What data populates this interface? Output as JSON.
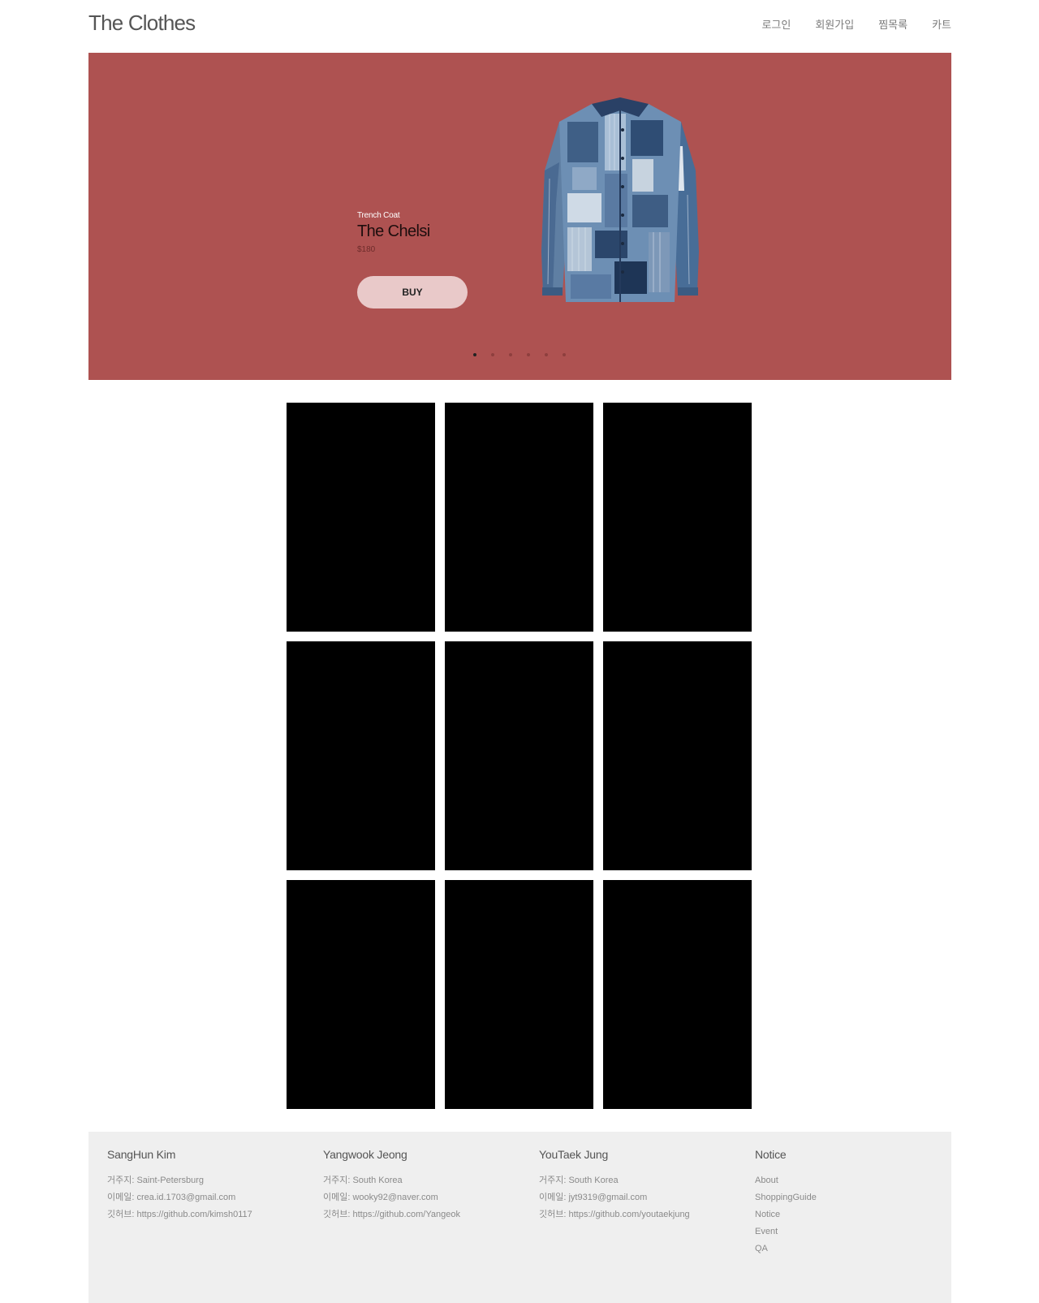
{
  "header": {
    "brand": "The Clothes",
    "nav": [
      "로그인",
      "회원가입",
      "찜목록",
      "카트"
    ]
  },
  "hero": {
    "category": "Trench Coat",
    "title": "The Chelsi",
    "price": "$180",
    "button_label": "BUY",
    "background_color": "#ae5251",
    "image_icon": "patchwork-denim-shirt",
    "slide_count": 6,
    "active_slide": 1
  },
  "products": {
    "tile_count": 9
  },
  "footer": {
    "columns": [
      {
        "name": "SangHun Kim",
        "address": "거주지: Saint-Petersburg",
        "email": "이메일: crea.id.1703@gmail.com",
        "github": "깃허브: https://github.com/kimsh0117"
      },
      {
        "name": "Yangwook Jeong",
        "address": "거주지: South Korea",
        "email": "이메일: wooky92@naver.com",
        "github": "깃허브: https://github.com/Yangeok"
      },
      {
        "name": "YouTaek Jung",
        "address": "거주지: South Korea",
        "email": "이메일: jyt9319@gmail.com",
        "github": "깃허브: https://github.com/youtaekjung"
      }
    ],
    "notice": {
      "heading": "Notice",
      "links": [
        "About",
        "ShoppingGuide",
        "Notice",
        "Event",
        "QA"
      ]
    }
  }
}
